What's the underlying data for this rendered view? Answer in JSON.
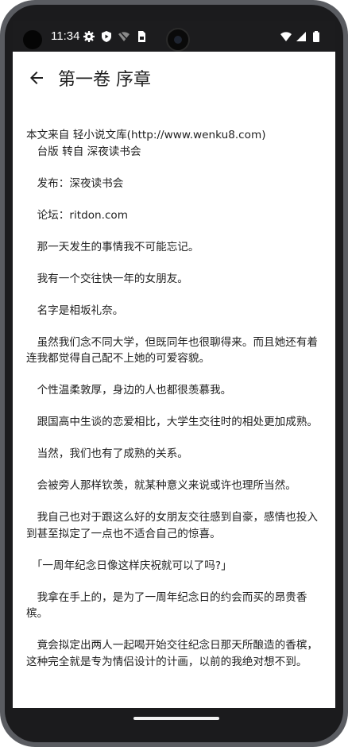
{
  "status_bar": {
    "time": "11:34",
    "left_icons": [
      "gear-icon",
      "shield-play-icon",
      "wifi-off-icon",
      "sim-card-icon"
    ],
    "right_icons": [
      "wifi-icon",
      "signal-icon",
      "battery-icon"
    ]
  },
  "app_bar": {
    "back_icon": "arrow-back-icon",
    "title": "第一卷 序章"
  },
  "content": {
    "paragraphs": [
      "本文来自 轻小说文库(http://www.wenku8.com)\n　台版 转自 深夜读书会",
      "　发布：深夜读书会",
      "　论坛：ritdon.com",
      "　那一天发生的事情我不可能忘记。",
      "　我有一个交往快一年的女朋友。",
      "　名字是相坂礼奈。",
      "　虽然我们念不同大学，但既同年也很聊得来。而且她还有着连我都觉得自己配不上她的可爱容貌。",
      "　个性温柔敦厚，身边的人也都很羡慕我。",
      "　跟国高中生谈的恋爱相比，大学生交往时的相处更加成熟。",
      "　当然，我们也有了成熟的关系。",
      "　会被旁人那样钦羡，就某种意义来说或许也理所当然。",
      "　我自己也对于跟这么好的女朋友交往感到自豪，感情也投入到甚至拟定了一点也不适合自己的惊喜。",
      "　「一周年纪念日像这样庆祝就可以了吗?」",
      "　我拿在手上的，是为了一周年纪念日的约会而买的昂贵香槟。",
      "　竟会拟定出两人一起喝开始交往纪念日那天所酿造的香槟，这种完全就是专为情侣设计的计画，以前的我绝对想不到。"
    ]
  },
  "colors": {
    "status_bar_bg": "#1c1c1e",
    "frame": "#5a5c61",
    "text": "#1f1f1f"
  }
}
